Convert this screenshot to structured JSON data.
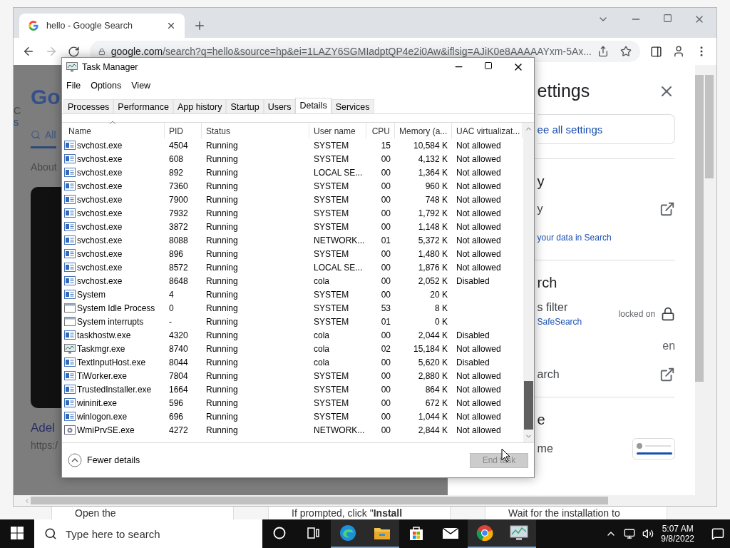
{
  "background_page": {
    "cards": [
      {
        "text": "Open the"
      },
      {
        "text": "If prompted, click \"**Install**"
      },
      {
        "text": "Wait for the installation to"
      }
    ]
  },
  "browser": {
    "tab_title": "hello - Google Search",
    "url_host": "google.com",
    "url_path": "/search?q=hello&source=hp&ei=1LAZY6SGMIadptQP4e2i0Aw&iflsig=AJiK0e8AAAAAYxm-5Ax...",
    "forward_disabled": true
  },
  "page": {
    "logo": "Go",
    "account_line": "C",
    "account_link": "s",
    "tab_all": "All",
    "about": "About",
    "result_title": "Adel",
    "result_url": "https:/"
  },
  "settings": {
    "title": "ettings",
    "see_all": "ee all settings",
    "sections": [
      {
        "heading": "y",
        "rows": [
          {
            "kind": "link-row",
            "label": "y"
          },
          {
            "kind": "link",
            "label": "your data in Search"
          }
        ]
      },
      {
        "heading": "rch",
        "rows": [
          {
            "kind": "filter",
            "label": "s filter",
            "link": "SafeSearch",
            "value": "locked on"
          },
          {
            "kind": "value",
            "value": "en"
          },
          {
            "kind": "link-row",
            "label": "arch"
          }
        ]
      },
      {
        "heading": "e",
        "rows": [
          {
            "kind": "theme",
            "label": "me"
          }
        ]
      }
    ]
  },
  "task_manager": {
    "title": "Task Manager",
    "menu": [
      "File",
      "Options",
      "View"
    ],
    "tabs": [
      {
        "label": "Processes",
        "selected": false
      },
      {
        "label": "Performance",
        "selected": false
      },
      {
        "label": "App history",
        "selected": false
      },
      {
        "label": "Startup",
        "selected": false
      },
      {
        "label": "Users",
        "selected": false
      },
      {
        "label": "Details",
        "selected": true
      },
      {
        "label": "Services",
        "selected": false
      }
    ],
    "columns": [
      "Name",
      "PID",
      "Status",
      "User name",
      "CPU",
      "Memory (a...",
      "UAC virtualizat..."
    ],
    "rows": [
      {
        "kind": "service",
        "name": "svchost.exe",
        "pid": "4504",
        "status": "Running",
        "user": "SYSTEM",
        "cpu": "15",
        "memory": "10,584 K",
        "uac": "Not allowed"
      },
      {
        "kind": "service",
        "name": "svchost.exe",
        "pid": "608",
        "status": "Running",
        "user": "SYSTEM",
        "cpu": "00",
        "memory": "4,132 K",
        "uac": "Not allowed"
      },
      {
        "kind": "service",
        "name": "svchost.exe",
        "pid": "892",
        "status": "Running",
        "user": "LOCAL SE...",
        "cpu": "00",
        "memory": "1,364 K",
        "uac": "Not allowed"
      },
      {
        "kind": "service",
        "name": "svchost.exe",
        "pid": "7360",
        "status": "Running",
        "user": "SYSTEM",
        "cpu": "00",
        "memory": "960 K",
        "uac": "Not allowed"
      },
      {
        "kind": "service",
        "name": "svchost.exe",
        "pid": "7900",
        "status": "Running",
        "user": "SYSTEM",
        "cpu": "00",
        "memory": "748 K",
        "uac": "Not allowed"
      },
      {
        "kind": "service",
        "name": "svchost.exe",
        "pid": "7932",
        "status": "Running",
        "user": "SYSTEM",
        "cpu": "00",
        "memory": "1,792 K",
        "uac": "Not allowed"
      },
      {
        "kind": "service",
        "name": "svchost.exe",
        "pid": "3872",
        "status": "Running",
        "user": "SYSTEM",
        "cpu": "00",
        "memory": "1,148 K",
        "uac": "Not allowed"
      },
      {
        "kind": "service",
        "name": "svchost.exe",
        "pid": "8088",
        "status": "Running",
        "user": "NETWORK...",
        "cpu": "01",
        "memory": "5,372 K",
        "uac": "Not allowed"
      },
      {
        "kind": "service",
        "name": "svchost.exe",
        "pid": "896",
        "status": "Running",
        "user": "SYSTEM",
        "cpu": "00",
        "memory": "1,480 K",
        "uac": "Not allowed"
      },
      {
        "kind": "service",
        "name": "svchost.exe",
        "pid": "8572",
        "status": "Running",
        "user": "LOCAL SE...",
        "cpu": "00",
        "memory": "1,876 K",
        "uac": "Not allowed"
      },
      {
        "kind": "service",
        "name": "svchost.exe",
        "pid": "8648",
        "status": "Running",
        "user": "cola",
        "cpu": "00",
        "memory": "2,052 K",
        "uac": "Disabled"
      },
      {
        "kind": "service",
        "name": "System",
        "pid": "4",
        "status": "Running",
        "user": "SYSTEM",
        "cpu": "00",
        "memory": "20 K"
      },
      {
        "kind": "blank",
        "name": "System Idle Process",
        "pid": "0",
        "status": "Running",
        "user": "SYSTEM",
        "cpu": "53",
        "memory": "8 K"
      },
      {
        "kind": "blank",
        "name": "System interrupts",
        "pid": "-",
        "status": "Running",
        "user": "SYSTEM",
        "cpu": "01",
        "memory": "0 K"
      },
      {
        "kind": "service",
        "name": "taskhostw.exe",
        "pid": "4320",
        "status": "Running",
        "user": "cola",
        "cpu": "00",
        "memory": "2,044 K",
        "uac": "Disabled"
      },
      {
        "kind": "monitor",
        "name": "Taskmgr.exe",
        "pid": "8740",
        "status": "Running",
        "user": "cola",
        "cpu": "02",
        "memory": "15,184 K",
        "uac": "Not allowed"
      },
      {
        "kind": "service",
        "name": "TextInputHost.exe",
        "pid": "8044",
        "status": "Running",
        "user": "cola",
        "cpu": "00",
        "memory": "5,620 K",
        "uac": "Disabled"
      },
      {
        "kind": "service",
        "name": "TiWorker.exe",
        "pid": "7804",
        "status": "Running",
        "user": "SYSTEM",
        "cpu": "00",
        "memory": "2,880 K",
        "uac": "Not allowed"
      },
      {
        "kind": "service",
        "name": "TrustedInstaller.exe",
        "pid": "1664",
        "status": "Running",
        "user": "SYSTEM",
        "cpu": "00",
        "memory": "864 K",
        "uac": "Not allowed"
      },
      {
        "kind": "service",
        "name": "wininit.exe",
        "pid": "596",
        "status": "Running",
        "user": "SYSTEM",
        "cpu": "00",
        "memory": "672 K",
        "uac": "Not allowed"
      },
      {
        "kind": "service",
        "name": "winlogon.exe",
        "pid": "696",
        "status": "Running",
        "user": "SYSTEM",
        "cpu": "00",
        "memory": "1,044 K",
        "uac": "Not allowed"
      },
      {
        "kind": "wmi",
        "name": "WmiPrvSE.exe",
        "pid": "4272",
        "status": "Running",
        "user": "NETWORK...",
        "cpu": "00",
        "memory": "2,844 K",
        "uac": "Not allowed"
      }
    ],
    "fewer_details": "Fewer details",
    "end_task": {
      "label": "End task",
      "disabled": true
    }
  },
  "taskbar": {
    "search_placeholder": "Type here to search",
    "time": "5:07 AM",
    "date": "9/8/2022",
    "apps": [
      {
        "kind": "cortana",
        "active": false
      },
      {
        "kind": "taskview",
        "active": false
      },
      {
        "kind": "edge",
        "active": true
      },
      {
        "kind": "explorer",
        "active": true
      },
      {
        "kind": "store",
        "active": false
      },
      {
        "kind": "mail",
        "active": false
      },
      {
        "kind": "chrome",
        "active": true
      },
      {
        "kind": "taskmgr",
        "active": true
      }
    ]
  }
}
